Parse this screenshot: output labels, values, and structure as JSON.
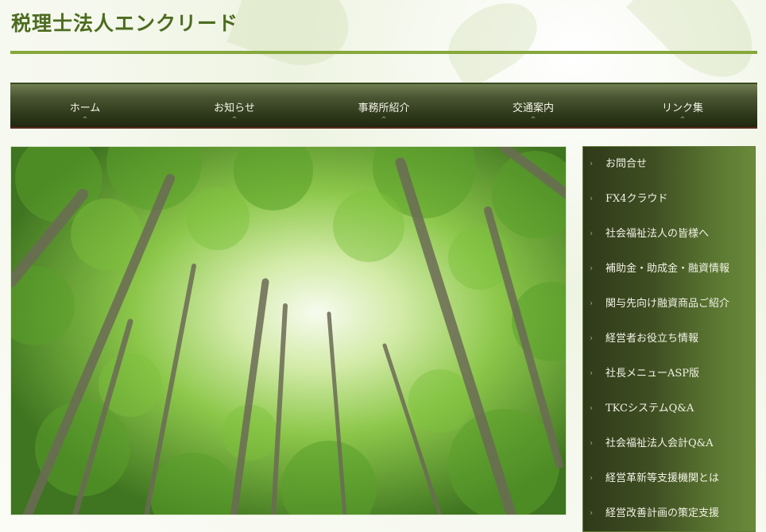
{
  "site": {
    "title": "税理士法人エンクリード"
  },
  "nav": {
    "items": [
      {
        "label": "ホーム"
      },
      {
        "label": "お知らせ"
      },
      {
        "label": "事務所紹介"
      },
      {
        "label": "交通案内"
      },
      {
        "label": "リンク集"
      }
    ]
  },
  "hero": {
    "image": "forest-canopy-photo"
  },
  "sidebar": {
    "items": [
      {
        "label": "お問合せ"
      },
      {
        "label": "FX4クラウド"
      },
      {
        "label": "社会福祉法人の皆様へ"
      },
      {
        "label": "補助金・助成金・融資情報"
      },
      {
        "label": "関与先向け融資商品ご紹介"
      },
      {
        "label": "経営者お役立ち情報"
      },
      {
        "label": "社長メニューASP版"
      },
      {
        "label": "TKCシステムQ&A"
      },
      {
        "label": "社会福祉法人会計Q&A"
      },
      {
        "label": "経営革新等支援機関とは"
      },
      {
        "label": "経営改善計画の策定支援"
      }
    ]
  },
  "colors": {
    "title": "#4c6c1f",
    "rule": "#86a83b",
    "nav_dark": "#2f3a1c",
    "sidebar_light": "#6a8a3a"
  }
}
